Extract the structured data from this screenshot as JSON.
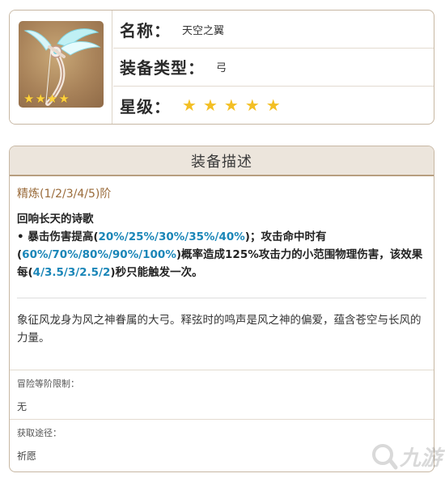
{
  "info": {
    "name_label": "名称：",
    "name_value": "天空之翼",
    "type_label": "装备类型：",
    "type_value": "弓",
    "rarity_label": "星级：",
    "rarity_stars": 5,
    "thumb_stars": 4,
    "thumb_icon": "bow-icon"
  },
  "description": {
    "header": "装备描述",
    "refine_label": "精炼(1/2/3/4/5)阶",
    "skill_name": "回响长天的诗歌",
    "skill_text": [
      {
        "t": " • 暴击伤害提高(",
        "hl": false
      },
      {
        "t": "20%/25%/30%/35%/40%",
        "hl": true
      },
      {
        "t": ")；攻击命中时有(",
        "hl": false
      },
      {
        "t": "60%/70%/80%/90%/100%",
        "hl": true
      },
      {
        "t": ")概率造成125%攻击力的小范围物理伤害，该效果每(",
        "hl": false
      },
      {
        "t": "4/3.5/3/2.5/2",
        "hl": true
      },
      {
        "t": ")秒只能触发一次。",
        "hl": false
      }
    ],
    "highlight_color": "#1a86b8",
    "lore": "象征风龙身为风之神眷属的大弓。释弦时的鸣声是风之神的偏爱，蕴含苍空与长风的力量。",
    "ascension_label": "冒险等阶限制：",
    "ascension_value": "无",
    "source_label": "获取途径：",
    "source_value": "祈愿"
  },
  "watermark": {
    "text": "九游",
    "icon": "9game-logo-icon"
  },
  "colors": {
    "star": "#f3bf24",
    "border": "#c7b7a3",
    "header_bg": "#ece5dc",
    "refine": "#9a6b3a"
  }
}
